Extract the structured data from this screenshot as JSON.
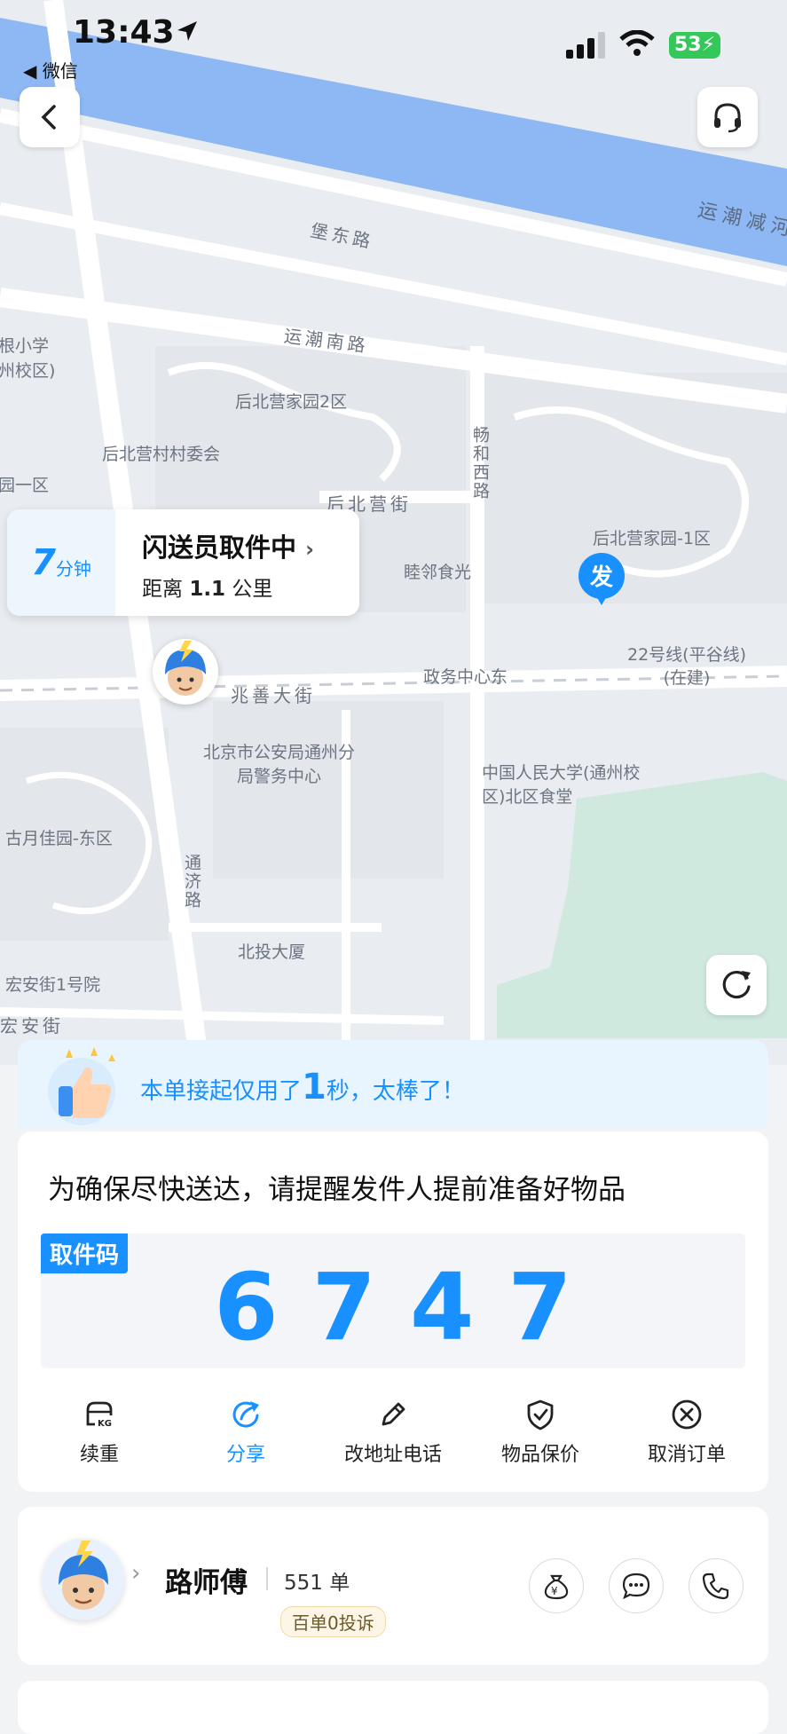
{
  "status_bar": {
    "time": "13:43",
    "back_app": "微信",
    "battery": "53"
  },
  "map": {
    "river_label": "运潮减河",
    "places": [
      {
        "name": "堡东路"
      },
      {
        "name": "运潮南路"
      },
      {
        "name": "后北营家园2区"
      },
      {
        "name": "后北营村村委会"
      },
      {
        "name": "后北营街"
      },
      {
        "name": "畅和西路"
      },
      {
        "name": "睦邻食光"
      },
      {
        "name": "后北营家园-1区"
      },
      {
        "name": "政务中心东"
      },
      {
        "name": "22号线(平谷线)(在建)"
      },
      {
        "name": "兆善大街"
      },
      {
        "name": "北京市公安局通州分局警务中心"
      },
      {
        "name": "中国人民大学(通州校区)北区食堂"
      },
      {
        "name": "古月佳园-东区"
      },
      {
        "name": "通济路"
      },
      {
        "name": "北投大厦"
      },
      {
        "name": "宏安街1号院"
      },
      {
        "name": "宏安街"
      },
      {
        "name": "根小学"
      },
      {
        "name": "州校区)"
      },
      {
        "name": "园一区"
      }
    ],
    "sender_marker": "发"
  },
  "eta": {
    "minutes": "7",
    "unit": "分钟",
    "status": "闪送员取件中",
    "distance_prefix": "距离",
    "distance_value": "1.1",
    "distance_unit": "公里"
  },
  "praise": {
    "text_before": "本单接起仅用了",
    "seconds": "1",
    "text_after": "秒，太棒了！"
  },
  "reminder": "为确保尽快送达，请提醒发件人提前准备好物品",
  "pickup_code": {
    "label": "取件码",
    "code": "6747"
  },
  "actions": [
    {
      "label": "续重",
      "icon": "weight-box-icon"
    },
    {
      "label": "分享",
      "icon": "share-icon",
      "active": true
    },
    {
      "label": "改地址电话",
      "icon": "pencil-icon"
    },
    {
      "label": "物品保价",
      "icon": "shield-check-icon"
    },
    {
      "label": "取消订单",
      "icon": "cancel-circle-icon"
    }
  ],
  "courier": {
    "name": "路师傅",
    "orders": "551",
    "orders_unit": "单",
    "complaints_badge": "百单0投诉"
  },
  "colors": {
    "accent": "#1890ff",
    "map_bg": "#e9ecf0",
    "river": "#8db8f4"
  }
}
